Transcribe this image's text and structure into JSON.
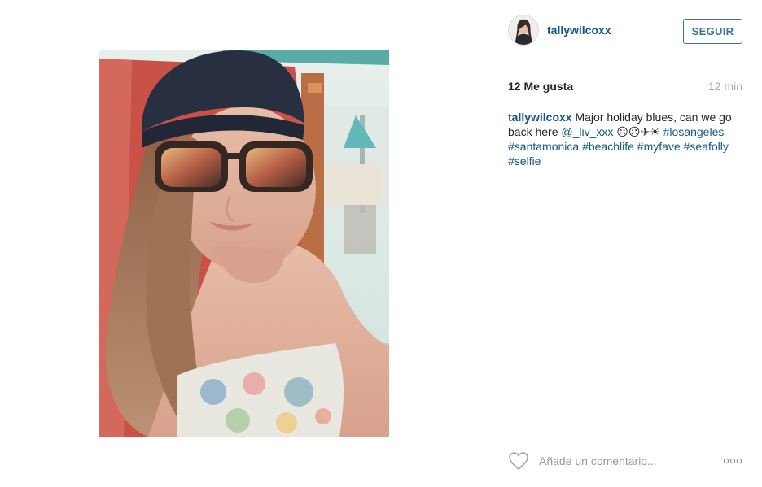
{
  "post": {
    "username": "tallywilcoxx",
    "follow_label": "SEGUIR",
    "likes": "12 Me gusta",
    "time_ago": "12 min",
    "caption": {
      "username": "tallywilcoxx",
      "text_1": " Major holiday blues, can we go back here ",
      "mention": "@_liv_xxx",
      "emoji": " ☹☹✈☀ ",
      "hashtags": [
        "#losangeles",
        "#santamonica",
        "#beachlife",
        "#myfave",
        "#seafolly",
        "#selfie"
      ]
    },
    "comment_placeholder": "Añade un comentario..."
  },
  "icons": {
    "like": "heart-icon",
    "options": "more-options-icon"
  },
  "colors": {
    "link": "#125688",
    "follow_border": "#3f729b",
    "muted": "#a5a7aa"
  }
}
